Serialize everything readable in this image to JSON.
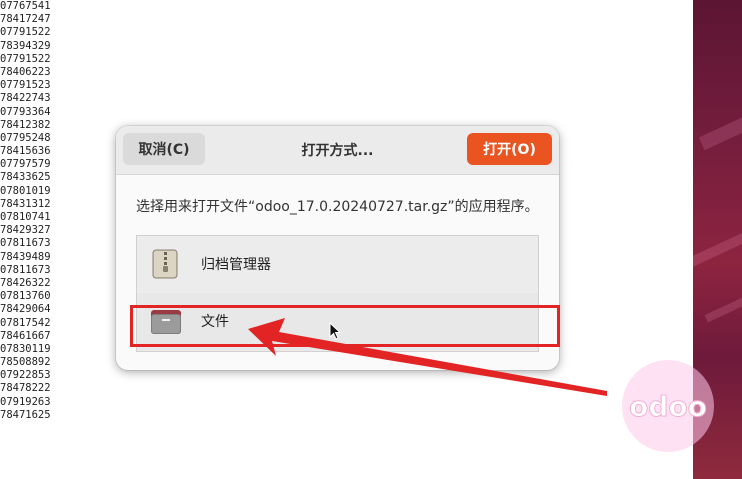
{
  "terminal": {
    "lines": [
      "07767541",
      "78417247",
      "07791522",
      "78394329",
      "07791522",
      "78406223",
      "07791523",
      "78422743",
      "07793364",
      "78412382",
      "07795248",
      "78415636",
      "07797579",
      "78433625",
      "07801019",
      "78431312",
      "07810741",
      "78429327",
      "07811673",
      "78439489",
      "07811673",
      "78426322",
      "07813760",
      "78429064",
      "07817542",
      "78461667",
      "07830119",
      "78508892",
      "07922853",
      "78478222",
      "07919263",
      "78471625"
    ]
  },
  "dialog": {
    "cancel_label": "取消(C)",
    "title": "打开方式...",
    "open_label": "打开(O)",
    "prompt": "选择用来打开文件“odoo_17.0.20240727.tar.gz”的应用程序。",
    "apps": [
      {
        "label": "归档管理器",
        "icon": "archive-manager-icon"
      },
      {
        "label": "文件",
        "icon": "files-folder-icon"
      }
    ]
  },
  "watermark": {
    "text": "odoo"
  },
  "colors": {
    "accent": "#e95420",
    "annotation": "#e32424"
  }
}
